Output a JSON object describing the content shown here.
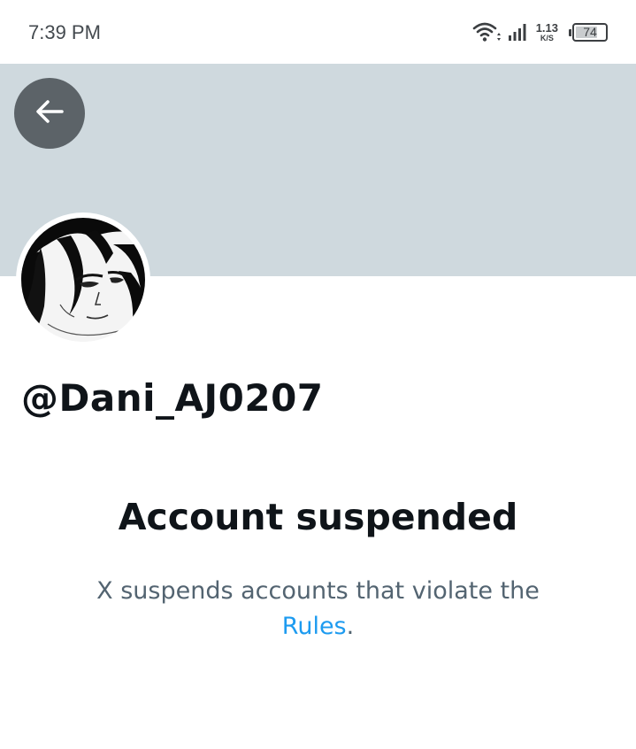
{
  "status_bar": {
    "time": "7:39 PM",
    "net_speed_value": "1.13",
    "net_speed_unit": "K/S",
    "battery_level": "74",
    "battery_fraction": 0.74,
    "icons": [
      "wifi-icon",
      "signal-icon",
      "battery-icon"
    ]
  },
  "header": {
    "back_icon": "arrow-left-icon",
    "banner_color": "#cfd9de"
  },
  "profile": {
    "handle": "@Dani_AJ0207",
    "avatar_icon": "anime-character-avatar"
  },
  "notice": {
    "title": "Account suspended",
    "description": "X suspends accounts that violate the",
    "link_text": "Rules",
    "trailing": ".",
    "link_color": "#1d9bf0"
  }
}
